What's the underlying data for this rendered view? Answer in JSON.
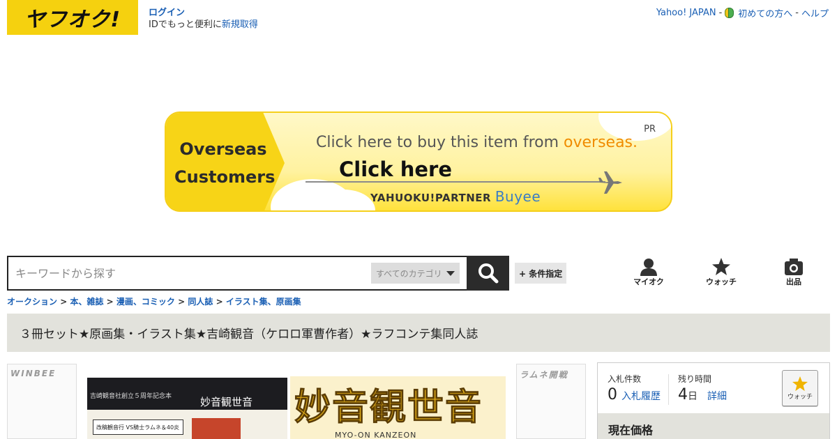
{
  "header": {
    "logo_text": "ヤフオク!",
    "login_label": "ログイン",
    "login_sub_prefix": "IDでもっと便利に",
    "register_label": "新規取得",
    "yahoo_link": "Yahoo! JAPAN",
    "sep": "-",
    "beginner_link": "初めての方へ",
    "help_link": "ヘルプ"
  },
  "banner": {
    "left_line1": "Overseas",
    "left_line2": "Customers",
    "line1_prefix": "Click here to buy this item from ",
    "line1_accent": "overseas.",
    "cta": "Click here",
    "partner": "YAHUOKU!PARTNER",
    "brand": "Buyee",
    "pr": "PR",
    "accent_color": "#f08c00"
  },
  "search": {
    "placeholder": "キーワードから探す",
    "category": "すべてのカテゴリ",
    "conditions": "+ 条件指定"
  },
  "nav": {
    "myauc": "マイオク",
    "watch": "ウォッチ",
    "sell": "出品"
  },
  "breadcrumb": {
    "items": [
      "オークション",
      "本、雑誌",
      "漫画、コミック",
      "同人誌",
      "イラスト集、原画集"
    ],
    "sep": ">"
  },
  "item": {
    "title": "３冊セット★原画集・イラスト集★吉崎観音（ケロロ軍曹作者）★ラフコンテ集同人誌"
  },
  "images": {
    "left_tag": "WINBEE",
    "right_tag": "ラムネ開戦",
    "img1_top": "吉崎観音社創立５周年記念本",
    "img1_title": "妙音観世音",
    "img1_box": "改稿観音行 VS騎士ラムネ＆40炎",
    "img2_title": "妙音観世音",
    "img2_sub": "MYO-ON KANZEON"
  },
  "bid": {
    "count_label": "入札件数",
    "count_value": "0",
    "history_link": "入札履歴",
    "time_label": "残り時間",
    "time_value": "4",
    "time_unit": "日",
    "detail_link": "詳細",
    "watch_label": "ウォッチ",
    "price_label": "現在価格"
  }
}
